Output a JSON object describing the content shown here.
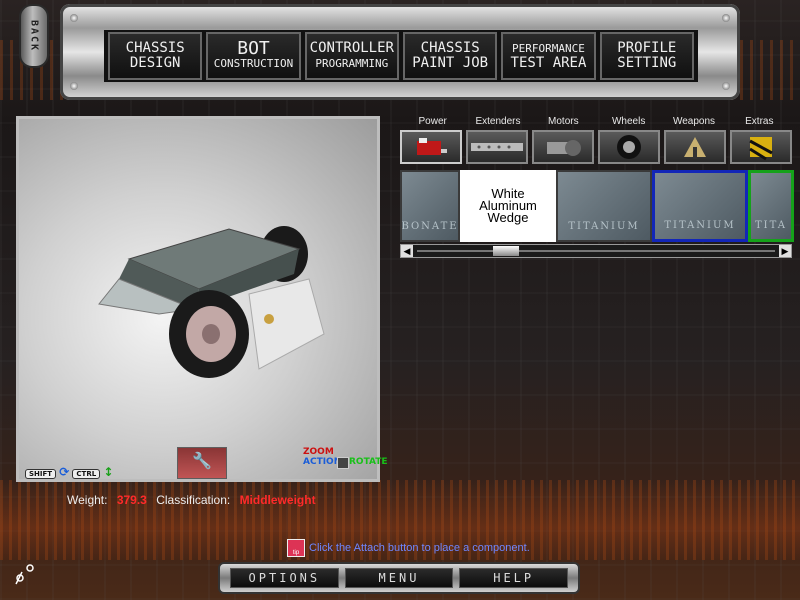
{
  "back_label": "BACK",
  "nav": [
    {
      "line1": "CHASSIS",
      "line2": "DESIGN"
    },
    {
      "line1": "BOT",
      "line2": "CONSTRUCTION"
    },
    {
      "line1": "CONTROLLER",
      "line2": "PROGRAMMING"
    },
    {
      "line1": "CHASSIS",
      "line2": "PAINT JOB"
    },
    {
      "line1": "PERFORMANCE",
      "line2": "TEST AREA"
    },
    {
      "line1": "PROFILE",
      "line2": "SETTING"
    }
  ],
  "viewport": {
    "shift_key": "SHIFT",
    "ctrl_key": "CTRL",
    "action_label": "ACTION",
    "zoom_label": "ZOOM",
    "rotate_label": "ROTATE"
  },
  "categories": {
    "labels": [
      "Power",
      "Extenders",
      "Motors",
      "Wheels",
      "Weapons",
      "Extras"
    ],
    "icons": [
      "battery-icon",
      "extender-bar-icon",
      "motor-icon",
      "wheel-icon",
      "weapon-icon",
      "extras-icon"
    ]
  },
  "components": {
    "partial_left": "BONATE",
    "selected": "White Aluminum Wedge",
    "items": [
      "TITANIUM",
      "TITANIUM",
      "TITA"
    ]
  },
  "stats": {
    "weight_label": "Weight:",
    "weight_value": "379.3",
    "class_label": "Classification:",
    "class_value": "Middleweight"
  },
  "hint": {
    "icon_text": "tip",
    "text": "Click the Attach button to place a component."
  },
  "bottom": [
    "OPTIONS",
    "MENU",
    "HELP"
  ],
  "colors": {
    "accent_red": "#ff2a2a",
    "hint_blue": "#6f86ff",
    "blue_border": "#1226b8",
    "green_border": "#15a21a"
  }
}
